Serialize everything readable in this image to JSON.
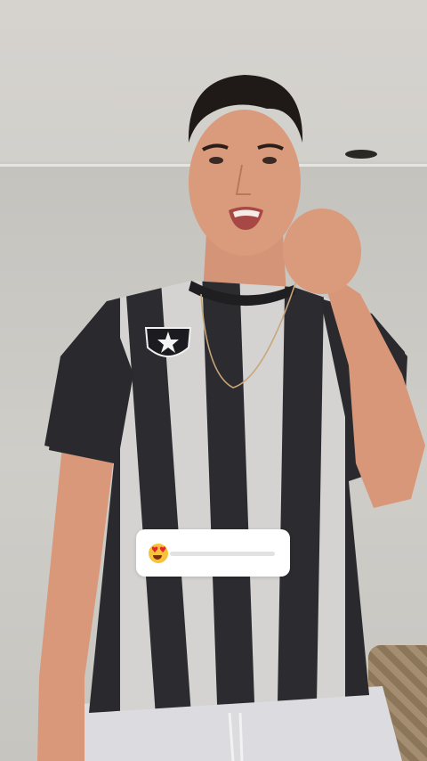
{
  "story": {
    "background_color": "#c9c7c2",
    "scene": {
      "jersey_colors": [
        "#2a2a2e",
        "#d4d3d1"
      ],
      "skin_color": "#d99b7c",
      "hair_color": "#1f1a17"
    }
  },
  "emoji_slider": {
    "emoji": "heart-eyes-emoji",
    "value": 0,
    "track_color": "#e2e2e2",
    "sticker_color": "#ffffff"
  }
}
